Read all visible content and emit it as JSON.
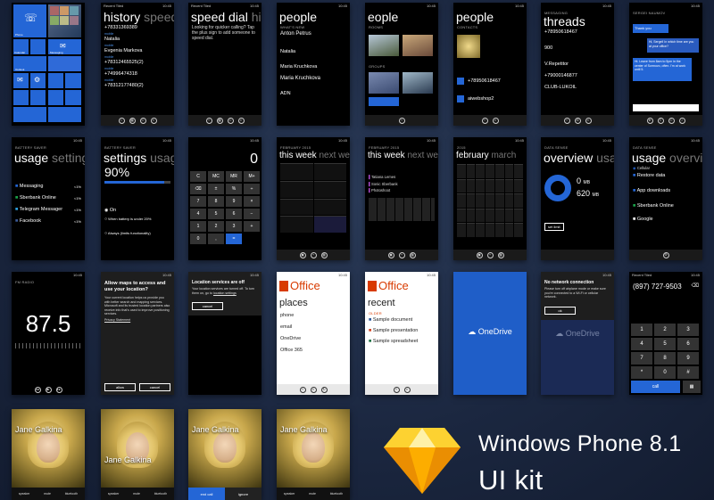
{
  "row1": {
    "start": {
      "tiles": [
        "Recent Tiles",
        "Messaging",
        "Calendar",
        "Outlook",
        "Google Mail",
        "Settings",
        "Phone"
      ]
    },
    "history": {
      "title": "history",
      "title_dim": "speed d",
      "caller": "Recent Tiled",
      "entries": [
        "+78331369389",
        "Natalia",
        "Evgenia Markova",
        "+78312465525(2)",
        "+74996474318",
        "+78312177480(2)"
      ]
    },
    "speed_dial": {
      "title": "speed dial",
      "title_dim": "histo",
      "caller": "Recent Tiled",
      "message": "Looking for quicker calling? Tap the plus sign to add someone to speed dial."
    },
    "people_whatsnew": {
      "title": "people",
      "section": "What's new",
      "entries": [
        "Anton Petrus",
        "Natalia",
        "Maria Kruchkova",
        "Maria Kruchkova",
        "ADN"
      ]
    },
    "people_rooms": {
      "title": "eople",
      "section1": "Rooms",
      "section2": "Groups"
    },
    "people_contacts": {
      "title": "people",
      "section": "Contacts",
      "entries": [
        "+78950618467",
        "aiwebshop2"
      ]
    },
    "threads": {
      "title": "threads",
      "section": "Messaging",
      "entries": [
        "+78950618467",
        "900",
        "V.Repetitor",
        "+79000146877",
        "CLUB-LUKOIL"
      ]
    },
    "conversation": {
      "header": "Sergei Naumov",
      "messages": [
        "Thank you",
        "Hi, Sergei! In which time are you at your office?",
        "Hi. Leave from 8am to 5pm in the center of Sormovo, often. I'm at work until 5."
      ]
    }
  },
  "row2": {
    "usage_settings": {
      "header": "Battery saver",
      "title": "usage",
      "title_dim": "settings",
      "apps": [
        "Messaging",
        "Sberbank Online",
        "Telegram Messager",
        "Facebook"
      ],
      "pcts": [
        "<1%",
        "<1%",
        "<1%",
        "<1%"
      ]
    },
    "settings_usage": {
      "header": "Battery saver",
      "title": "settings",
      "title_dim": "usage",
      "percent": "90%",
      "options": [
        "On",
        "When battery is under 20%",
        "Always (limits functionality)"
      ]
    },
    "calculator": {
      "display": "0",
      "keys": [
        "C",
        "MC",
        "MR",
        "M+",
        "⌫",
        "±",
        "%",
        "÷",
        "7",
        "8",
        "9",
        "×",
        "4",
        "5",
        "6",
        "−",
        "1",
        "2",
        "3",
        "+",
        "0",
        ",",
        "="
      ]
    },
    "calendar_week1": {
      "header": "February 2015",
      "title": "this week",
      "title_dim": "next wee"
    },
    "calendar_week2": {
      "header": "February 2015",
      "title": "this week",
      "title_dim": "next wee",
      "events": [
        "Tatiana Lemes",
        "Sonic Sberbank",
        "Photoshoot"
      ]
    },
    "calendar_month": {
      "header": "2015",
      "title": "february",
      "title_dim": "march"
    },
    "data_overview": {
      "header": "Data sense",
      "title": "overview",
      "title_dim": "usage",
      "value1": "0",
      "unit1": "MB",
      "value2": "620",
      "unit2": "MB",
      "button": "set limit"
    },
    "data_usage": {
      "header": "Data sense",
      "title": "usage",
      "title_dim": "overview",
      "apps": [
        "Cellular",
        "Restore data",
        "App downloads",
        "Sberbank Online",
        "Google"
      ]
    }
  },
  "row3": {
    "radio": {
      "header": "FM radio",
      "freq": "87.5"
    },
    "location_ask": {
      "title": "Allow maps to access and use your location?",
      "body": "Your current location helps us provide you with better search and mapping services. Microsoft and its trusted location partners also receive info that's used to improve positioning services.",
      "link": "Privacy Statement",
      "allow": "allow",
      "cancel": "cancel"
    },
    "location_off": {
      "title": "Location services are off",
      "body": "Your location services are turned off. To turn them on, go to",
      "link": "location settings",
      "cancel": "cancel"
    },
    "office_places": {
      "brand": "Office",
      "title": "places",
      "items": [
        "phone",
        "email",
        "OneDrive",
        "Office 365"
      ]
    },
    "office_recent": {
      "brand": "Office",
      "title": "recent",
      "section": "Older",
      "items": [
        "Sample document",
        "Sample presentation",
        "Sample spreadsheet"
      ]
    },
    "onedrive": {
      "brand": "OneDrive"
    },
    "onedrive_offline": {
      "title": "No network connection",
      "body": "Please turn off airplane mode or make sure you're connected to a Wi-Fi or cellular network.",
      "ok": "ok",
      "brand": "OneDrive"
    },
    "dialer": {
      "header": "Recent Tiled",
      "number": "(897) 727-9503",
      "keys": [
        "1",
        "2",
        "3",
        "4",
        "5",
        "6",
        "7",
        "8",
        "9",
        "*",
        "0",
        "#"
      ],
      "call": "call"
    }
  },
  "row4": {
    "calls": [
      {
        "name": "Jane Galkina",
        "actions": [
          "speaker",
          "mute",
          "bluetooth"
        ]
      },
      {
        "name": "Jane Galkina",
        "actions": [
          "speaker",
          "mute",
          "bluetooth"
        ]
      },
      {
        "name": "Jane Galkina",
        "accept": "end call",
        "ignore": "ignore"
      },
      {
        "name": "Jane Galkina",
        "actions": [
          "speaker",
          "mute",
          "bluetooth"
        ]
      }
    ]
  },
  "title": {
    "line1": "Windows Phone 8.1",
    "line2": "UI kit"
  },
  "colors": {
    "accent": "#2466d6",
    "office": "#d83b01",
    "sketch_gold": "#f7b500"
  }
}
